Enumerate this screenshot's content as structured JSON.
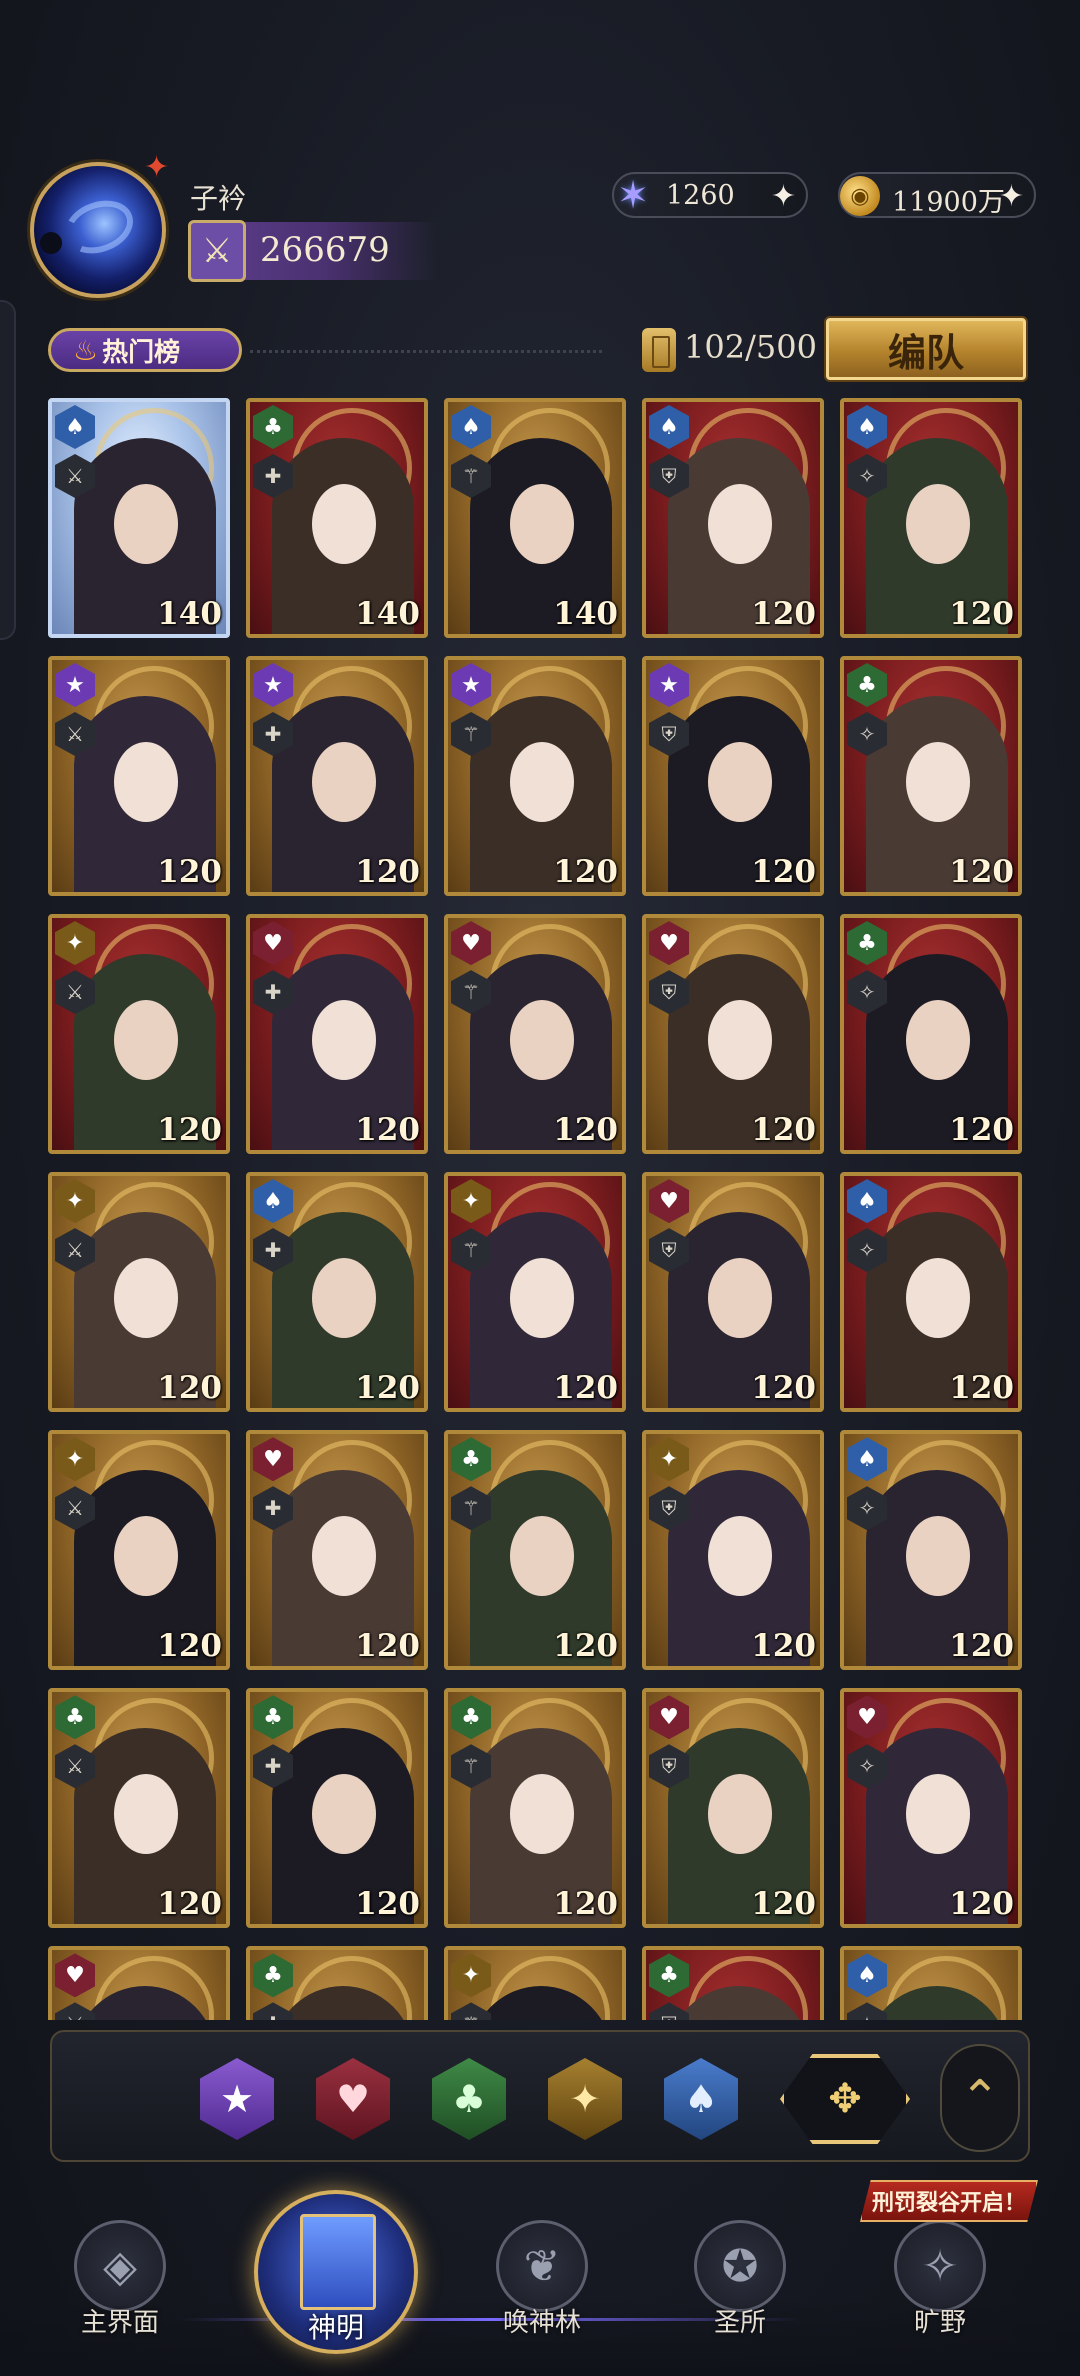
{
  "player": {
    "name": "子衿",
    "power": "266679"
  },
  "currencies": [
    {
      "icon": "star-gem-icon",
      "value": "1260",
      "add": "✦"
    },
    {
      "icon": "gold-coin-icon",
      "value": "11900万",
      "add": "✦"
    }
  ],
  "ranking": {
    "label": "热门榜"
  },
  "roster": {
    "count": "102/500"
  },
  "team_button": "编队",
  "cards": [
    {
      "suit": "spade",
      "level": "140",
      "bg": "blue"
    },
    {
      "suit": "club",
      "level": "140",
      "bg": "red"
    },
    {
      "suit": "spade",
      "level": "140",
      "bg": "gold"
    },
    {
      "suit": "spade",
      "level": "120",
      "bg": "red"
    },
    {
      "suit": "spade",
      "level": "120",
      "bg": "red"
    },
    {
      "suit": "star",
      "level": "120",
      "bg": "gold"
    },
    {
      "suit": "star",
      "level": "120",
      "bg": "gold"
    },
    {
      "suit": "star",
      "level": "120",
      "bg": "gold"
    },
    {
      "suit": "star",
      "level": "120",
      "bg": "gold"
    },
    {
      "suit": "club",
      "level": "120",
      "bg": "red"
    },
    {
      "suit": "spark",
      "level": "120",
      "bg": "red"
    },
    {
      "suit": "heart",
      "level": "120",
      "bg": "red"
    },
    {
      "suit": "heart",
      "level": "120",
      "bg": "gold"
    },
    {
      "suit": "heart",
      "level": "120",
      "bg": "gold"
    },
    {
      "suit": "club",
      "level": "120",
      "bg": "red"
    },
    {
      "suit": "spark",
      "level": "120",
      "bg": "gold"
    },
    {
      "suit": "spade",
      "level": "120",
      "bg": "gold"
    },
    {
      "suit": "spark",
      "level": "120",
      "bg": "red"
    },
    {
      "suit": "heart",
      "level": "120",
      "bg": "gold"
    },
    {
      "suit": "spade",
      "level": "120",
      "bg": "red"
    },
    {
      "suit": "spark",
      "level": "120",
      "bg": "gold"
    },
    {
      "suit": "heart",
      "level": "120",
      "bg": "gold"
    },
    {
      "suit": "club",
      "level": "120",
      "bg": "gold"
    },
    {
      "suit": "spark",
      "level": "120",
      "bg": "gold"
    },
    {
      "suit": "spade",
      "level": "120",
      "bg": "gold"
    },
    {
      "suit": "club",
      "level": "120",
      "bg": "gold"
    },
    {
      "suit": "club",
      "level": "120",
      "bg": "gold"
    },
    {
      "suit": "club",
      "level": "120",
      "bg": "gold"
    },
    {
      "suit": "heart",
      "level": "120",
      "bg": "gold"
    },
    {
      "suit": "heart",
      "level": "120",
      "bg": "red"
    },
    {
      "suit": "heart",
      "level": "",
      "bg": "gold"
    },
    {
      "suit": "club",
      "level": "",
      "bg": "gold"
    },
    {
      "suit": "spark",
      "level": "",
      "bg": "gold"
    },
    {
      "suit": "club",
      "level": "",
      "bg": "red"
    },
    {
      "suit": "spade",
      "level": "",
      "bg": "gold"
    }
  ],
  "filters": [
    {
      "name": "star-filter",
      "glyph": "★"
    },
    {
      "name": "heart-filter",
      "glyph": "♥"
    },
    {
      "name": "club-filter",
      "glyph": "♣"
    },
    {
      "name": "spark-filter",
      "glyph": "✦"
    },
    {
      "name": "spade-filter",
      "glyph": "♠"
    },
    {
      "name": "all-filter",
      "glyph": "✥"
    }
  ],
  "nav": {
    "main": "主界面",
    "gods": "神明",
    "summon": "唤神林",
    "sanctuary": "圣所",
    "wild": "旷野",
    "event": "刑罚裂谷开启！"
  }
}
